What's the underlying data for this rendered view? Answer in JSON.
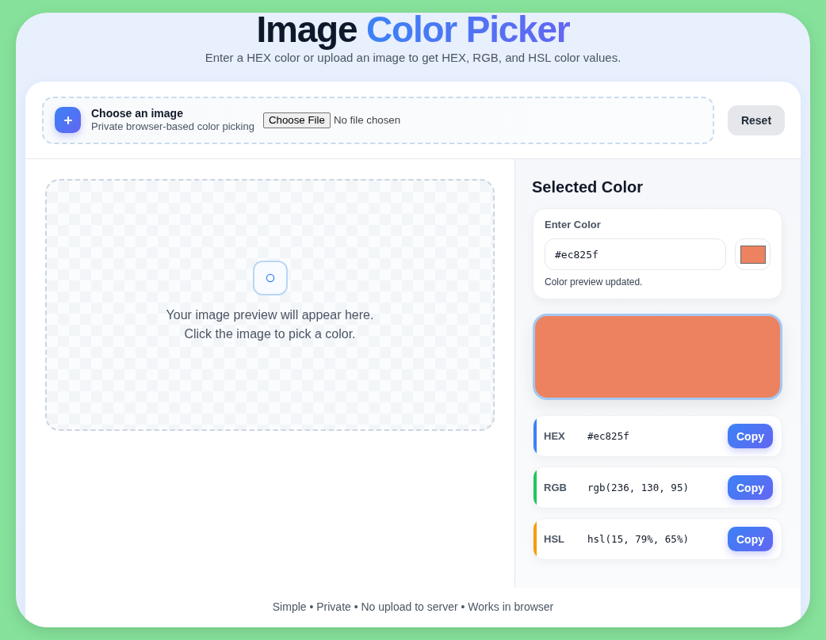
{
  "header": {
    "title_parts": [
      {
        "text": "Image",
        "accent": false
      },
      {
        "text": "Color Picker",
        "accent": true
      }
    ],
    "subtitle": "Enter a HEX color or upload an image to get HEX, RGB, and HSL color values."
  },
  "upload": {
    "title": "Choose an image",
    "subtitle": "Private browser-based color picking",
    "file_button": "Choose File",
    "file_status": "No file chosen",
    "reset_button": "Reset"
  },
  "preview": {
    "message_lines": [
      "Your image preview will appear here.",
      "Click the image to pick a color."
    ]
  },
  "selected_color": {
    "heading": "Selected Color",
    "input_label": "Enter Color",
    "input_value": "#ec825f",
    "color": "#ec825f",
    "status": "Color preview updated."
  },
  "values": [
    {
      "label": "HEX",
      "value": "#ec825f",
      "color": "#3b82f6",
      "button": "Copy"
    },
    {
      "label": "RGB",
      "value": "rgb(236, 130, 95)",
      "color": "#22c55e",
      "button": "Copy"
    },
    {
      "label": "HSL",
      "value": "hsl(15, 79%, 65%)",
      "color": "#f59e0b",
      "button": "Copy"
    }
  ],
  "footer": "Simple • Private • No upload to server • Works in browser"
}
